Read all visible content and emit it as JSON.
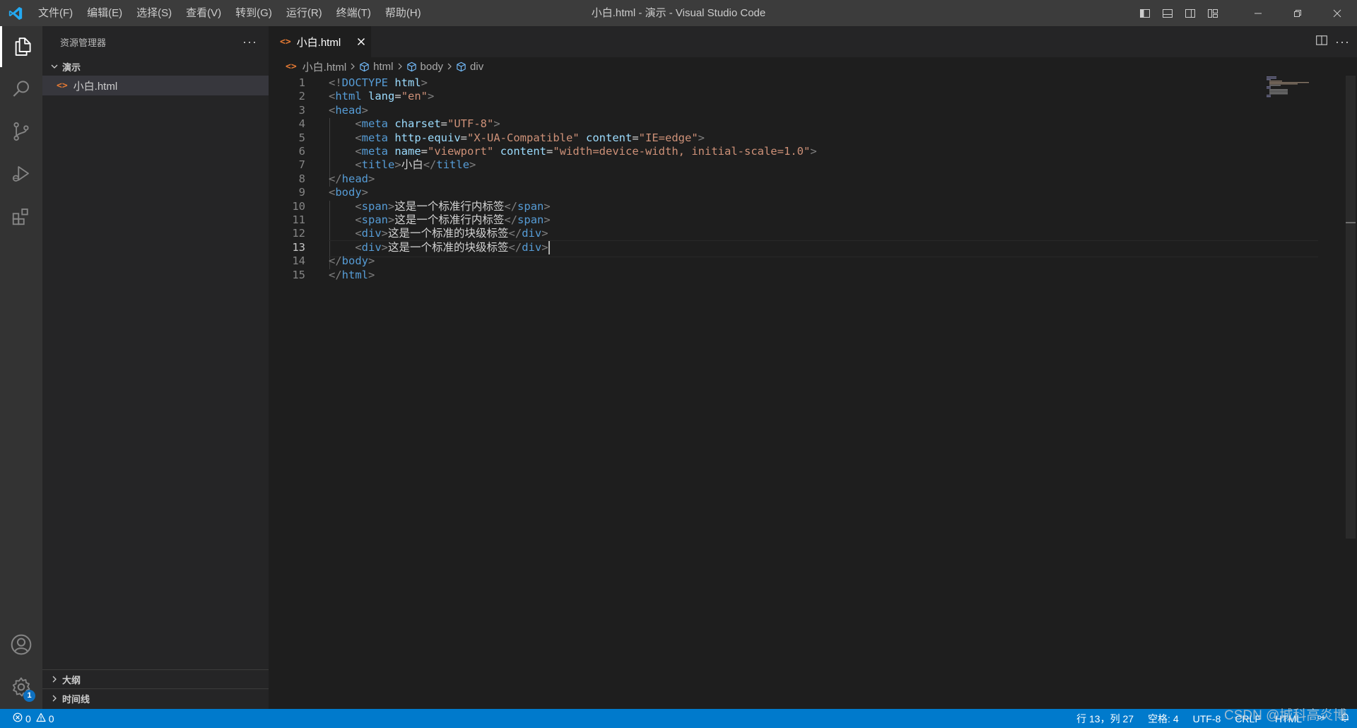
{
  "window": {
    "title": "小白.html - 演示 - Visual Studio Code",
    "menu": [
      "文件(F)",
      "编辑(E)",
      "选择(S)",
      "查看(V)",
      "转到(G)",
      "运行(R)",
      "终端(T)",
      "帮助(H)"
    ]
  },
  "sidebar": {
    "title": "资源管理器",
    "folder": "演示",
    "file": "小白.html",
    "file_glyph": "<>",
    "sections": [
      "大纲",
      "时间线"
    ]
  },
  "activity": {
    "settings_badge": "1"
  },
  "editor": {
    "tab_label": "小白.html",
    "breadcrumb": [
      "小白.html",
      "html",
      "body",
      "div"
    ],
    "current_line": 13,
    "line_numbers": [
      "1",
      "2",
      "3",
      "4",
      "5",
      "6",
      "7",
      "8",
      "9",
      "10",
      "11",
      "12",
      "13",
      "14",
      "15"
    ],
    "lines": [
      [
        [
          "punc",
          "<!"
        ],
        [
          "tag",
          "DOCTYPE"
        ],
        [
          "text",
          " "
        ],
        [
          "attr",
          "html"
        ],
        [
          "punc",
          ">"
        ]
      ],
      [
        [
          "punc",
          "<"
        ],
        [
          "tag",
          "html"
        ],
        [
          "text",
          " "
        ],
        [
          "attr",
          "lang"
        ],
        [
          "text",
          "="
        ],
        [
          "str",
          "\"en\""
        ],
        [
          "punc",
          ">"
        ]
      ],
      [
        [
          "punc",
          "<"
        ],
        [
          "tag",
          "head"
        ],
        [
          "punc",
          ">"
        ]
      ],
      [
        [
          "text",
          "    "
        ],
        [
          "punc",
          "<"
        ],
        [
          "tag",
          "meta"
        ],
        [
          "text",
          " "
        ],
        [
          "attr",
          "charset"
        ],
        [
          "text",
          "="
        ],
        [
          "str",
          "\"UTF-8\""
        ],
        [
          "punc",
          ">"
        ]
      ],
      [
        [
          "text",
          "    "
        ],
        [
          "punc",
          "<"
        ],
        [
          "tag",
          "meta"
        ],
        [
          "text",
          " "
        ],
        [
          "attr",
          "http-equiv"
        ],
        [
          "text",
          "="
        ],
        [
          "str",
          "\"X-UA-Compatible\""
        ],
        [
          "text",
          " "
        ],
        [
          "attr",
          "content"
        ],
        [
          "text",
          "="
        ],
        [
          "str",
          "\"IE=edge\""
        ],
        [
          "punc",
          ">"
        ]
      ],
      [
        [
          "text",
          "    "
        ],
        [
          "punc",
          "<"
        ],
        [
          "tag",
          "meta"
        ],
        [
          "text",
          " "
        ],
        [
          "attr",
          "name"
        ],
        [
          "text",
          "="
        ],
        [
          "str",
          "\"viewport\""
        ],
        [
          "text",
          " "
        ],
        [
          "attr",
          "content"
        ],
        [
          "text",
          "="
        ],
        [
          "str",
          "\"width=device-width, initial-scale=1.0\""
        ],
        [
          "punc",
          ">"
        ]
      ],
      [
        [
          "text",
          "    "
        ],
        [
          "punc",
          "<"
        ],
        [
          "tag",
          "title"
        ],
        [
          "punc",
          ">"
        ],
        [
          "text",
          "小白"
        ],
        [
          "punc",
          "</"
        ],
        [
          "tag",
          "title"
        ],
        [
          "punc",
          ">"
        ]
      ],
      [
        [
          "punc",
          "</"
        ],
        [
          "tag",
          "head"
        ],
        [
          "punc",
          ">"
        ]
      ],
      [
        [
          "punc",
          "<"
        ],
        [
          "tag",
          "body"
        ],
        [
          "punc",
          ">"
        ]
      ],
      [
        [
          "text",
          "    "
        ],
        [
          "punc",
          "<"
        ],
        [
          "tag",
          "span"
        ],
        [
          "punc",
          ">"
        ],
        [
          "text",
          "这是一个标准行内标签"
        ],
        [
          "punc",
          "</"
        ],
        [
          "tag",
          "span"
        ],
        [
          "punc",
          ">"
        ]
      ],
      [
        [
          "text",
          "    "
        ],
        [
          "punc",
          "<"
        ],
        [
          "tag",
          "span"
        ],
        [
          "punc",
          ">"
        ],
        [
          "text",
          "这是一个标准行内标签"
        ],
        [
          "punc",
          "</"
        ],
        [
          "tag",
          "span"
        ],
        [
          "punc",
          ">"
        ]
      ],
      [
        [
          "text",
          "    "
        ],
        [
          "punc",
          "<"
        ],
        [
          "tag",
          "div"
        ],
        [
          "punc",
          ">"
        ],
        [
          "text",
          "这是一个标准的块级标签"
        ],
        [
          "punc",
          "</"
        ],
        [
          "tag",
          "div"
        ],
        [
          "punc",
          ">"
        ]
      ],
      [
        [
          "text",
          "    "
        ],
        [
          "punc",
          "<"
        ],
        [
          "tag",
          "div"
        ],
        [
          "punc",
          ">"
        ],
        [
          "text",
          "这是一个标准的块级标签"
        ],
        [
          "punc",
          "</"
        ],
        [
          "tag",
          "div"
        ],
        [
          "punc",
          ">"
        ]
      ],
      [
        [
          "punc",
          "</"
        ],
        [
          "tag",
          "body"
        ],
        [
          "punc",
          ">"
        ]
      ],
      [
        [
          "punc",
          "</"
        ],
        [
          "tag",
          "html"
        ],
        [
          "punc",
          ">"
        ]
      ]
    ]
  },
  "statusbar": {
    "errors": "0",
    "warnings": "0",
    "position": "行 13，列 27",
    "spaces": "空格: 4",
    "encoding": "UTF-8",
    "eol": "CRLF",
    "language": "HTML"
  },
  "watermark": "CSDN @城科高炎博",
  "colors": {
    "statusbar": "#007acc",
    "titlebar": "#3c3c3c",
    "activitybar": "#333333",
    "sidebar": "#252526",
    "editor": "#1e1e1e",
    "tag": "#569cd6",
    "attribute": "#9cdcfe",
    "string": "#ce9178",
    "file_icon": "#e37933"
  },
  "icons": [
    "vscode-logo-icon",
    "explorer-icon",
    "search-icon",
    "source-control-icon",
    "run-debug-icon",
    "extensions-icon",
    "account-icon",
    "settings-gear-icon",
    "split-editor-icon",
    "close-icon",
    "chevron-down-icon",
    "chevron-right-icon",
    "error-icon",
    "warning-icon",
    "feedback-icon",
    "bell-icon"
  ]
}
